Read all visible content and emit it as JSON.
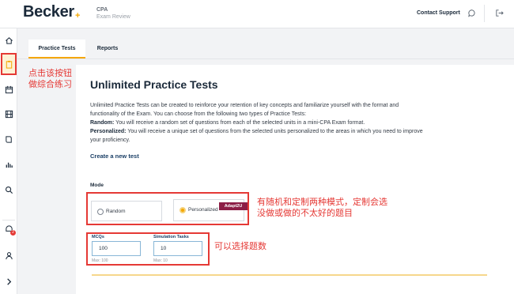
{
  "header": {
    "logo": "Becker",
    "logo_plus": "+",
    "product_name": "CPA",
    "product_sub": "Exam Review",
    "contact_label": "Contact Support"
  },
  "sidebar": {
    "icons": [
      "home-icon",
      "clipboard-icon",
      "calendar-icon",
      "film-icon",
      "book-icon",
      "bar-chart-icon",
      "search-icon",
      "notification-icon",
      "user-icon",
      "chevron-right-icon"
    ],
    "badge": "2"
  },
  "tabs": {
    "practice_tests": "Practice Tests",
    "reports": "Reports"
  },
  "main": {
    "title": "Unlimited Practice Tests",
    "intro_line1": "Unlimited Practice Tests can be created to reinforce your retention of key concepts and familiarize yourself with the format and",
    "intro_line2": "functionality of the Exam. You can choose from the following two types of Practice Tests:",
    "random_term": "Random:",
    "random_desc": " You will receive a random set of questions from each of the selected units in a mini-CPA Exam format.",
    "personalized_term": "Personalized:",
    "personalized_desc_1": " You will receive a unique set of questions from the selected units personalized to the areas in which you need to improve",
    "personalized_desc_2": "your proficiency.",
    "create_link": "Create a new test",
    "mode_label": "Mode",
    "mode_options": {
      "random": "Random",
      "personalized": "Personalized",
      "personalized_badge": "Adapt2U"
    },
    "selected_mode": "Personalized",
    "mcqs_label": "MCQs",
    "mcqs_value": "100",
    "mcqs_max": "Max: 100",
    "sim_label": "Simulation Tasks",
    "sim_value": "10",
    "sim_max": "Max: 10"
  },
  "annotations": {
    "sidebar_note_line1": "点击该按钮",
    "sidebar_note_line2": "做综合练习",
    "mode_note_line1": "有随机和定制两种模式，定制会选",
    "mode_note_line2": "没做或做的不太好的题目",
    "count_note": "可以选择题数"
  },
  "colors": {
    "accent": "#f5a700",
    "annotation": "#e53935",
    "badge": "#8c1d45",
    "navy": "#1b2a3a"
  }
}
